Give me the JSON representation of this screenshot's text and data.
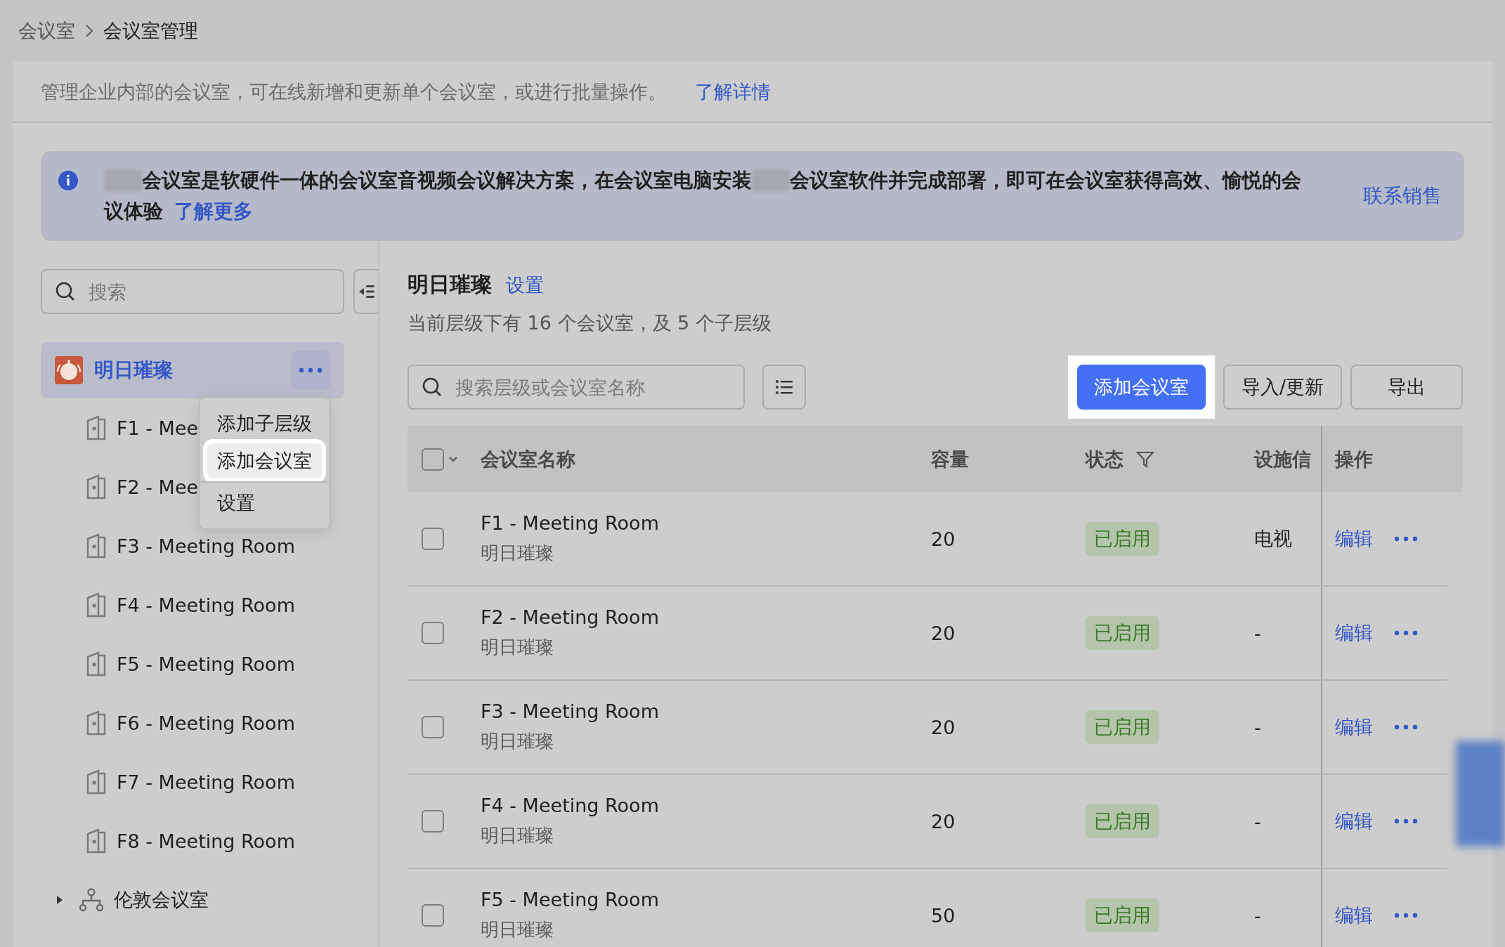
{
  "breadcrumb": [
    {
      "label": "会议室"
    },
    {
      "label": "会议室管理"
    }
  ],
  "description": {
    "text": "管理企业内部的会议室，可在线新增和更新单个会议室，或进行批量操作。",
    "link": "了解详情"
  },
  "banner": {
    "lines": [
      [
        {
          "kind": "redacted"
        },
        {
          "kind": "text",
          "text": "会议室是软硬件一体的会议室音视频会议解决方案，在会议室电脑安装"
        },
        {
          "kind": "redacted"
        },
        {
          "kind": "text",
          "text": "会议室软件并完成部署，即可在会议室获得高效、愉悦的会"
        }
      ],
      [
        {
          "kind": "text",
          "text": "议体验"
        }
      ]
    ],
    "link": "了解更多",
    "action": "联系销售"
  },
  "sidebar": {
    "search": {
      "placeholder": "搜索"
    },
    "tree": [
      {
        "label": "明日璀璨",
        "kind": "org",
        "selected": true,
        "children": [
          {
            "label": "F1 - Mee",
            "kind": "room",
            "selected": false
          },
          {
            "label": "F2 - Mee",
            "kind": "room",
            "selected": false
          },
          {
            "label": "F3 - Meeting Room",
            "kind": "room",
            "selected": false
          },
          {
            "label": "F4 - Meeting Room",
            "kind": "room",
            "selected": false
          },
          {
            "label": "F5 - Meeting Room",
            "kind": "room",
            "selected": false
          },
          {
            "label": "F6 - Meeting Room",
            "kind": "room",
            "selected": false
          },
          {
            "label": "F7 - Meeting Room",
            "kind": "room",
            "selected": false
          },
          {
            "label": "F8 - Meeting Room",
            "kind": "room",
            "selected": false
          }
        ]
      },
      {
        "label": "伦敦会议室",
        "kind": "group",
        "selected": false,
        "expanded": false
      }
    ],
    "menu": {
      "items": [
        {
          "label": "添加子层级",
          "selected": false,
          "divider_before": false
        },
        {
          "label": "添加会议室",
          "selected": true,
          "divider_before": false
        },
        {
          "label": "设置",
          "selected": false,
          "divider_before": true
        }
      ]
    }
  },
  "main": {
    "title": "明日璀璨",
    "settings_link": "设置",
    "summary": "当前层级下有 16 个会议室，及 5 个子层级",
    "search": {
      "placeholder": "搜索层级或会议室名称"
    },
    "buttons": [
      {
        "label": "添加会议室",
        "kind": "primary",
        "highlighted": true
      },
      {
        "label": "导入/更新",
        "kind": "default",
        "highlighted": false
      },
      {
        "label": "导出",
        "kind": "default",
        "highlighted": false
      }
    ],
    "table": {
      "select_all_checked": false,
      "columns": [
        {
          "label": "会议室名称",
          "filter": false
        },
        {
          "label": "容量",
          "filter": false
        },
        {
          "label": "状态",
          "filter": true
        },
        {
          "label": "设施信",
          "filter": false
        },
        {
          "label": "操作",
          "filter": false
        }
      ],
      "rows": [
        {
          "name": "F1 - Meeting Room",
          "location": "明日璀璨",
          "capacity": "20",
          "status": "已启用",
          "facility": "电视",
          "action": "编辑",
          "checked": false
        },
        {
          "name": "F2 - Meeting Room",
          "location": "明日璀璨",
          "capacity": "20",
          "status": "已启用",
          "facility": "-",
          "action": "编辑",
          "checked": false
        },
        {
          "name": "F3 - Meeting Room",
          "location": "明日璀璨",
          "capacity": "20",
          "status": "已启用",
          "facility": "-",
          "action": "编辑",
          "checked": false
        },
        {
          "name": "F4 - Meeting Room",
          "location": "明日璀璨",
          "capacity": "20",
          "status": "已启用",
          "facility": "-",
          "action": "编辑",
          "checked": false
        },
        {
          "name": "F5 - Meeting Room",
          "location": "明日璀璨",
          "capacity": "50",
          "status": "已启用",
          "facility": "-",
          "action": "编辑",
          "checked": false
        }
      ]
    }
  }
}
